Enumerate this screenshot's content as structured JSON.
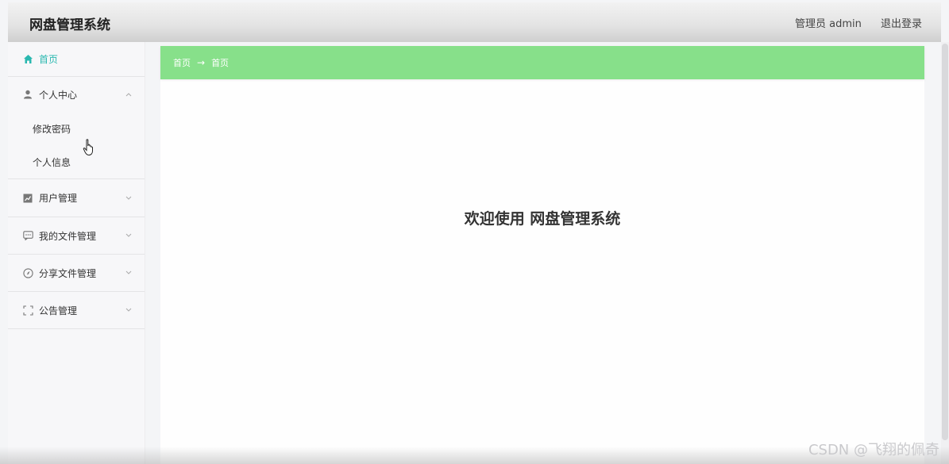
{
  "header": {
    "title": "网盘管理系统",
    "user_label": "管理员 admin",
    "logout_label": "退出登录"
  },
  "sidebar": {
    "items": [
      {
        "label": "首页",
        "icon": "home-icon",
        "active": true
      },
      {
        "label": "个人中心",
        "icon": "user-icon",
        "expanded": true,
        "children": [
          {
            "label": "修改密码"
          },
          {
            "label": "个人信息"
          }
        ]
      },
      {
        "label": "用户管理",
        "icon": "chart-icon"
      },
      {
        "label": "我的文件管理",
        "icon": "chat-icon"
      },
      {
        "label": "分享文件管理",
        "icon": "compass-icon"
      },
      {
        "label": "公告管理",
        "icon": "fullscreen-icon"
      }
    ]
  },
  "breadcrumb": {
    "root": "首页",
    "current": "首页"
  },
  "main": {
    "welcome": "欢迎使用 网盘管理系统"
  },
  "watermark": "CSDN @飞翔的佩奇",
  "colors": {
    "accent": "#2ab8b0",
    "breadcrumb_bg": "#87e08a",
    "header_bg": "#e3e3e3"
  }
}
